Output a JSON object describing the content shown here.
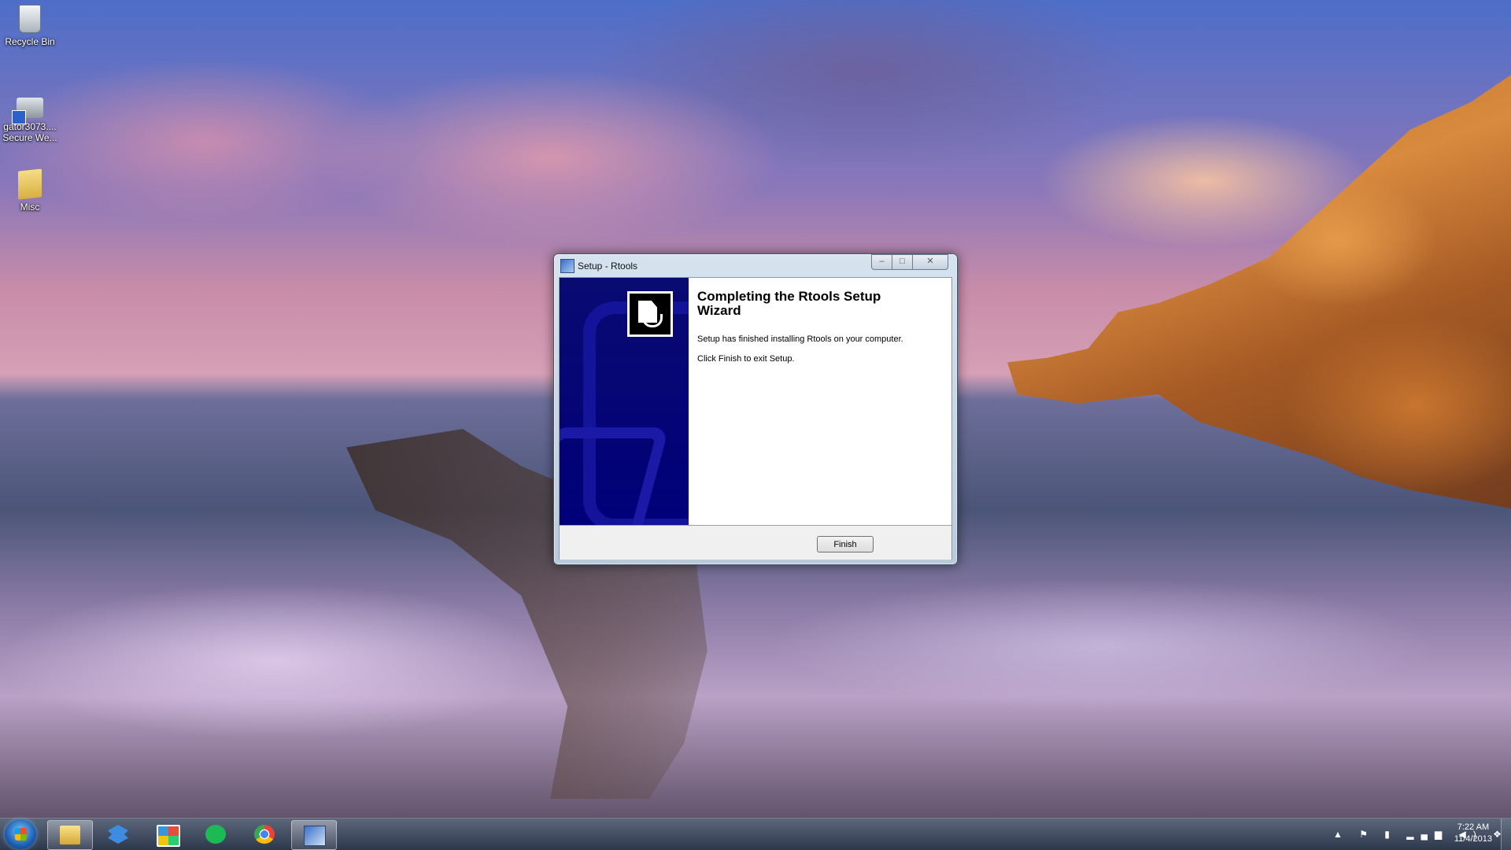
{
  "desktop": {
    "icons": [
      {
        "label": "Recycle Bin",
        "icon": "recycle-bin-icon"
      },
      {
        "label": "gator3073....\nSecure We...",
        "icon": "shortcut-icon"
      },
      {
        "label": "Misc",
        "icon": "folder-icon"
      }
    ]
  },
  "window": {
    "title": "Setup - Rtools",
    "controls": {
      "minimize": "‒",
      "maximize": "□",
      "close": "✕"
    },
    "heading": "Completing the Rtools Setup Wizard",
    "paragraph1": "Setup has finished installing Rtools on your computer.",
    "paragraph2": "Click Finish to exit Setup.",
    "finish_label": "Finish",
    "banner_color": "#000078"
  },
  "taskbar": {
    "pinned": [
      {
        "name": "windows-explorer",
        "icon": "folder-icon"
      },
      {
        "name": "dropbox",
        "icon": "dropbox-icon"
      },
      {
        "name": "apps",
        "icon": "apps-icon"
      },
      {
        "name": "spotify",
        "icon": "spotify-icon"
      },
      {
        "name": "chrome",
        "icon": "chrome-icon"
      },
      {
        "name": "setup",
        "icon": "setup-icon",
        "active": true
      }
    ],
    "tray_icons": "▲ ⚑ ▮ ▂▄▆ ◀) ❖",
    "time": "7:22 AM",
    "date": "11/4/2013"
  }
}
